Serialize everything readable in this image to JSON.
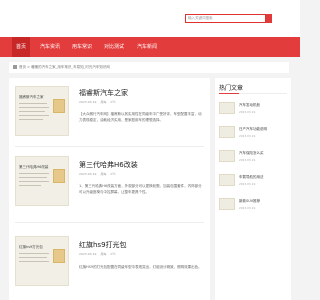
{
  "header": {
    "search_placeholder": "输入关键词搜索"
  },
  "nav": {
    "items": [
      {
        "label": "首页"
      },
      {
        "label": "汽车资讯"
      },
      {
        "label": "用车常识"
      },
      {
        "label": "对比测试"
      },
      {
        "label": "汽车新闻"
      }
    ]
  },
  "breadcrumb": {
    "text": "首页 > 暖暖的汽车之家_用车常识_车易知_时光汽车知识网"
  },
  "posts": [
    {
      "thumb_title": "福睿斯汽车之家",
      "title": "福睿斯汽车之家",
      "date": "2023-03-19",
      "category": "用车",
      "views": "0℃",
      "excerpt": "【大众朗行汽车网】福睿斯以其实用性在同级车中广受好评，车型配置丰富，动力表现稳定，油耗经济实用，是家庭用车的理想选择。"
    },
    {
      "thumb_title": "第三代哈弗H6改装",
      "title": "第三代哈弗H6改装",
      "date": "2023-03-19",
      "category": "用车",
      "views": "0℃",
      "excerpt": "1、第三代哈弗H6改装方面，外观部分可以更换轮毂、加装包围套件，内饰部分可以升级座椅与中控屏幕，让整车更具个性。"
    },
    {
      "thumb_title": "红旗hs9打光包",
      "title": "红旗hs9打光包",
      "date": "2023-03-19",
      "category": "用车",
      "views": "0℃",
      "excerpt": "红旗HS9的打光包配置在同级车型中表现突出，灯组设计精致，照明效果出色。"
    }
  ],
  "sidebar": {
    "title": "热门文章",
    "items": [
      {
        "label": "汽车发动机舱",
        "date": "2023-03-19"
      },
      {
        "label": "日产汽车功能说明",
        "date": "2023-03-19"
      },
      {
        "label": "汽车保险怎么买",
        "date": "2023-03-19"
      },
      {
        "label": "车载导航的用法",
        "date": "2023-03-19"
      },
      {
        "label": "新款SUV推荐",
        "date": "2023-03-19"
      }
    ]
  }
}
